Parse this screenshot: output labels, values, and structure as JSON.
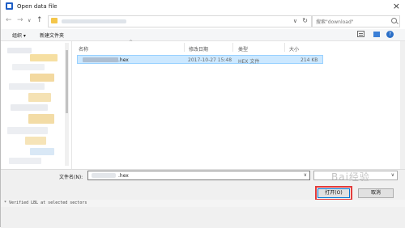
{
  "window": {
    "title": "Open data file",
    "close_glyph": "×"
  },
  "nav": {
    "back_glyph": "←",
    "forward_glyph": "→",
    "recent_glyph": "∨",
    "up_glyph": "↑",
    "address_dropdown_glyph": "∨",
    "refresh_glyph": "↻",
    "search_placeholder": "搜索\"download\""
  },
  "toolbar": {
    "organize_label": "组织 ▾",
    "new_folder_label": "新建文件夹"
  },
  "columns": {
    "name": "名称",
    "date": "修改日期",
    "type": "类型",
    "size": "大小"
  },
  "files": [
    {
      "name": ".hex",
      "modified": "2017-10-27 15:48",
      "type": "HEX 文件",
      "size": "214 KB"
    }
  ],
  "bottom": {
    "filename_label": "文件名(N):",
    "filename_value": ".hex",
    "dropdown_glyph": "∨",
    "open_label": "打开(O)",
    "cancel_label": "取消"
  },
  "status_text": "* Verified LBL at selected sectors",
  "colors": {
    "selection": "#cce8ff",
    "highlight_box": "#e33b3b",
    "accent": "#0078d7"
  }
}
